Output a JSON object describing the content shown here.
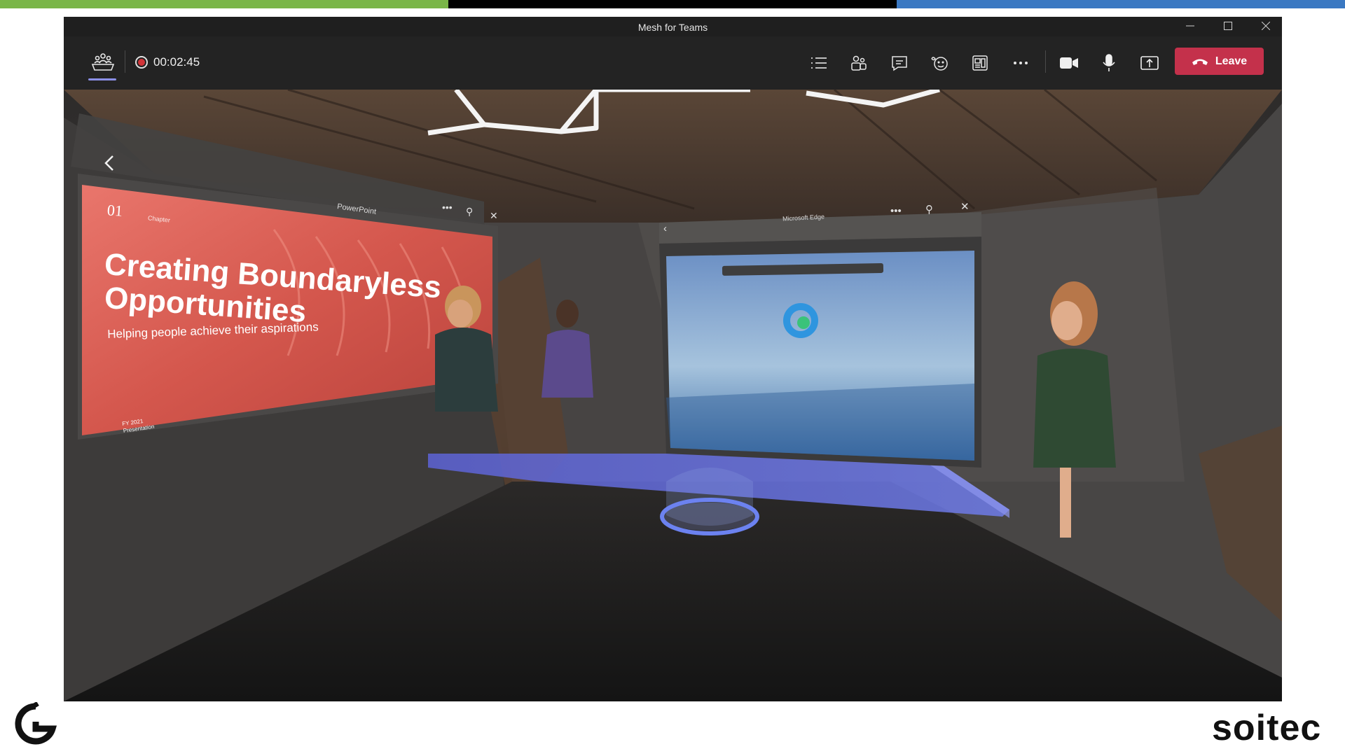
{
  "window": {
    "title": "Mesh for Teams",
    "controls": [
      "minimize-icon",
      "maximize-icon",
      "close-icon"
    ]
  },
  "toolbar": {
    "meeting_icon": "mesh-meeting-icon",
    "recording_time": "00:02:45",
    "buttons": [
      {
        "name": "agenda-button",
        "icon": "list-icon"
      },
      {
        "name": "participants-button",
        "icon": "people-icon"
      },
      {
        "name": "chat-button",
        "icon": "chat-icon"
      },
      {
        "name": "reactions-button",
        "icon": "emoji-icon"
      },
      {
        "name": "rooms-button",
        "icon": "rooms-icon"
      },
      {
        "name": "more-actions-button",
        "icon": "more-icon"
      },
      {
        "name": "camera-button",
        "icon": "camera-icon"
      },
      {
        "name": "mic-button",
        "icon": "mic-icon"
      },
      {
        "name": "share-button",
        "icon": "share-icon"
      }
    ],
    "leave_label": "Leave"
  },
  "scene": {
    "powerpoint": {
      "window_label": "PowerPoint",
      "chapter_number": "01",
      "chapter_label": "Chapter",
      "title_line1": "Creating Boundaryless",
      "title_line2": "Opportunities",
      "subtitle": "Helping people achieve their aspirations",
      "footer_line1": "FY 2021",
      "footer_line2": "Presentation"
    },
    "edge": {
      "window_label": "Microsoft Edge"
    }
  },
  "footer": {
    "company_name": "soitec"
  },
  "colors": {
    "strip_green": "#7ab648",
    "strip_black": "#000000",
    "strip_blue": "#3a78c2",
    "leave_red": "#c4314b",
    "accent_purple": "#8b8fe6"
  }
}
